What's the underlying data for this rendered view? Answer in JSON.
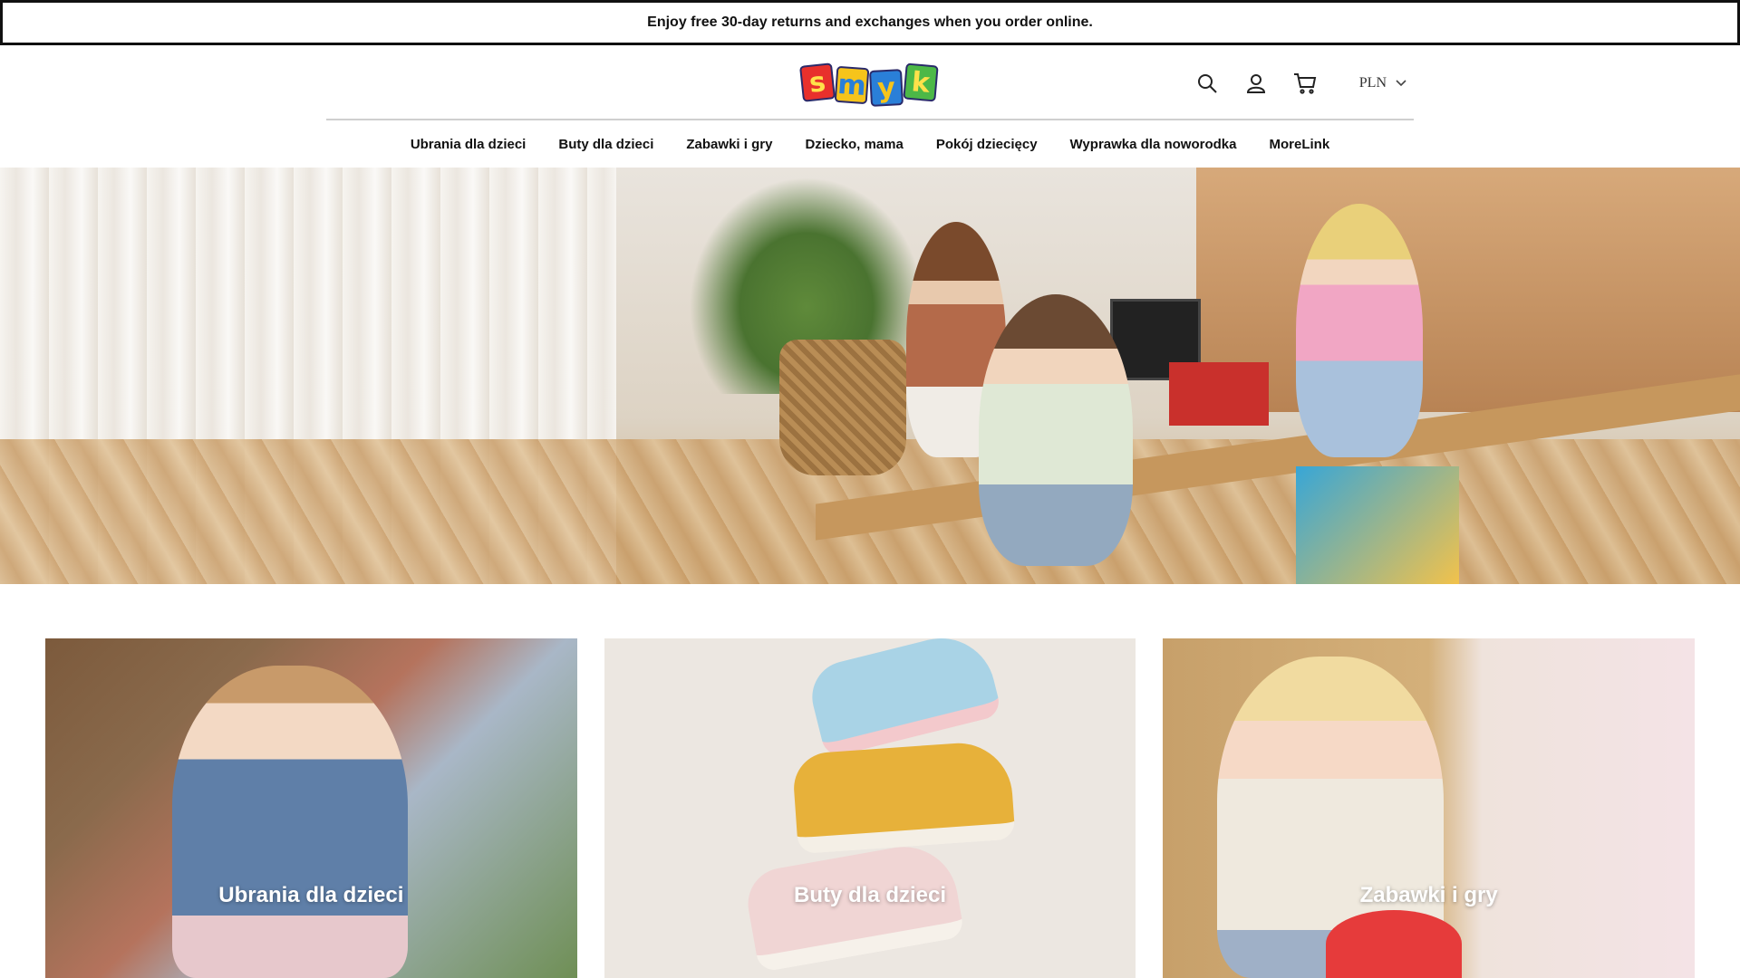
{
  "announcement": "Enjoy free 30-day returns and exchanges when you order online.",
  "logo": {
    "letters": [
      "s",
      "m",
      "y",
      "k"
    ],
    "colors": [
      "#e8302c",
      "#f6c41b",
      "#2a7fd8",
      "#4cb847"
    ]
  },
  "header": {
    "icons": [
      "search-icon",
      "account-icon",
      "cart-icon"
    ],
    "currency": "PLN"
  },
  "nav": {
    "items": [
      "Ubrania dla dzieci",
      "Buty dla dzieci",
      "Zabawki i gry",
      "Dziecko, mama",
      "Pokój dziecięcy",
      "Wyprawka dla noworodka",
      "MoreLink"
    ]
  },
  "categories": [
    {
      "label": "Ubrania dla dzieci"
    },
    {
      "label": "Buty dla dzieci"
    },
    {
      "label": "Zabawki i gry"
    }
  ]
}
